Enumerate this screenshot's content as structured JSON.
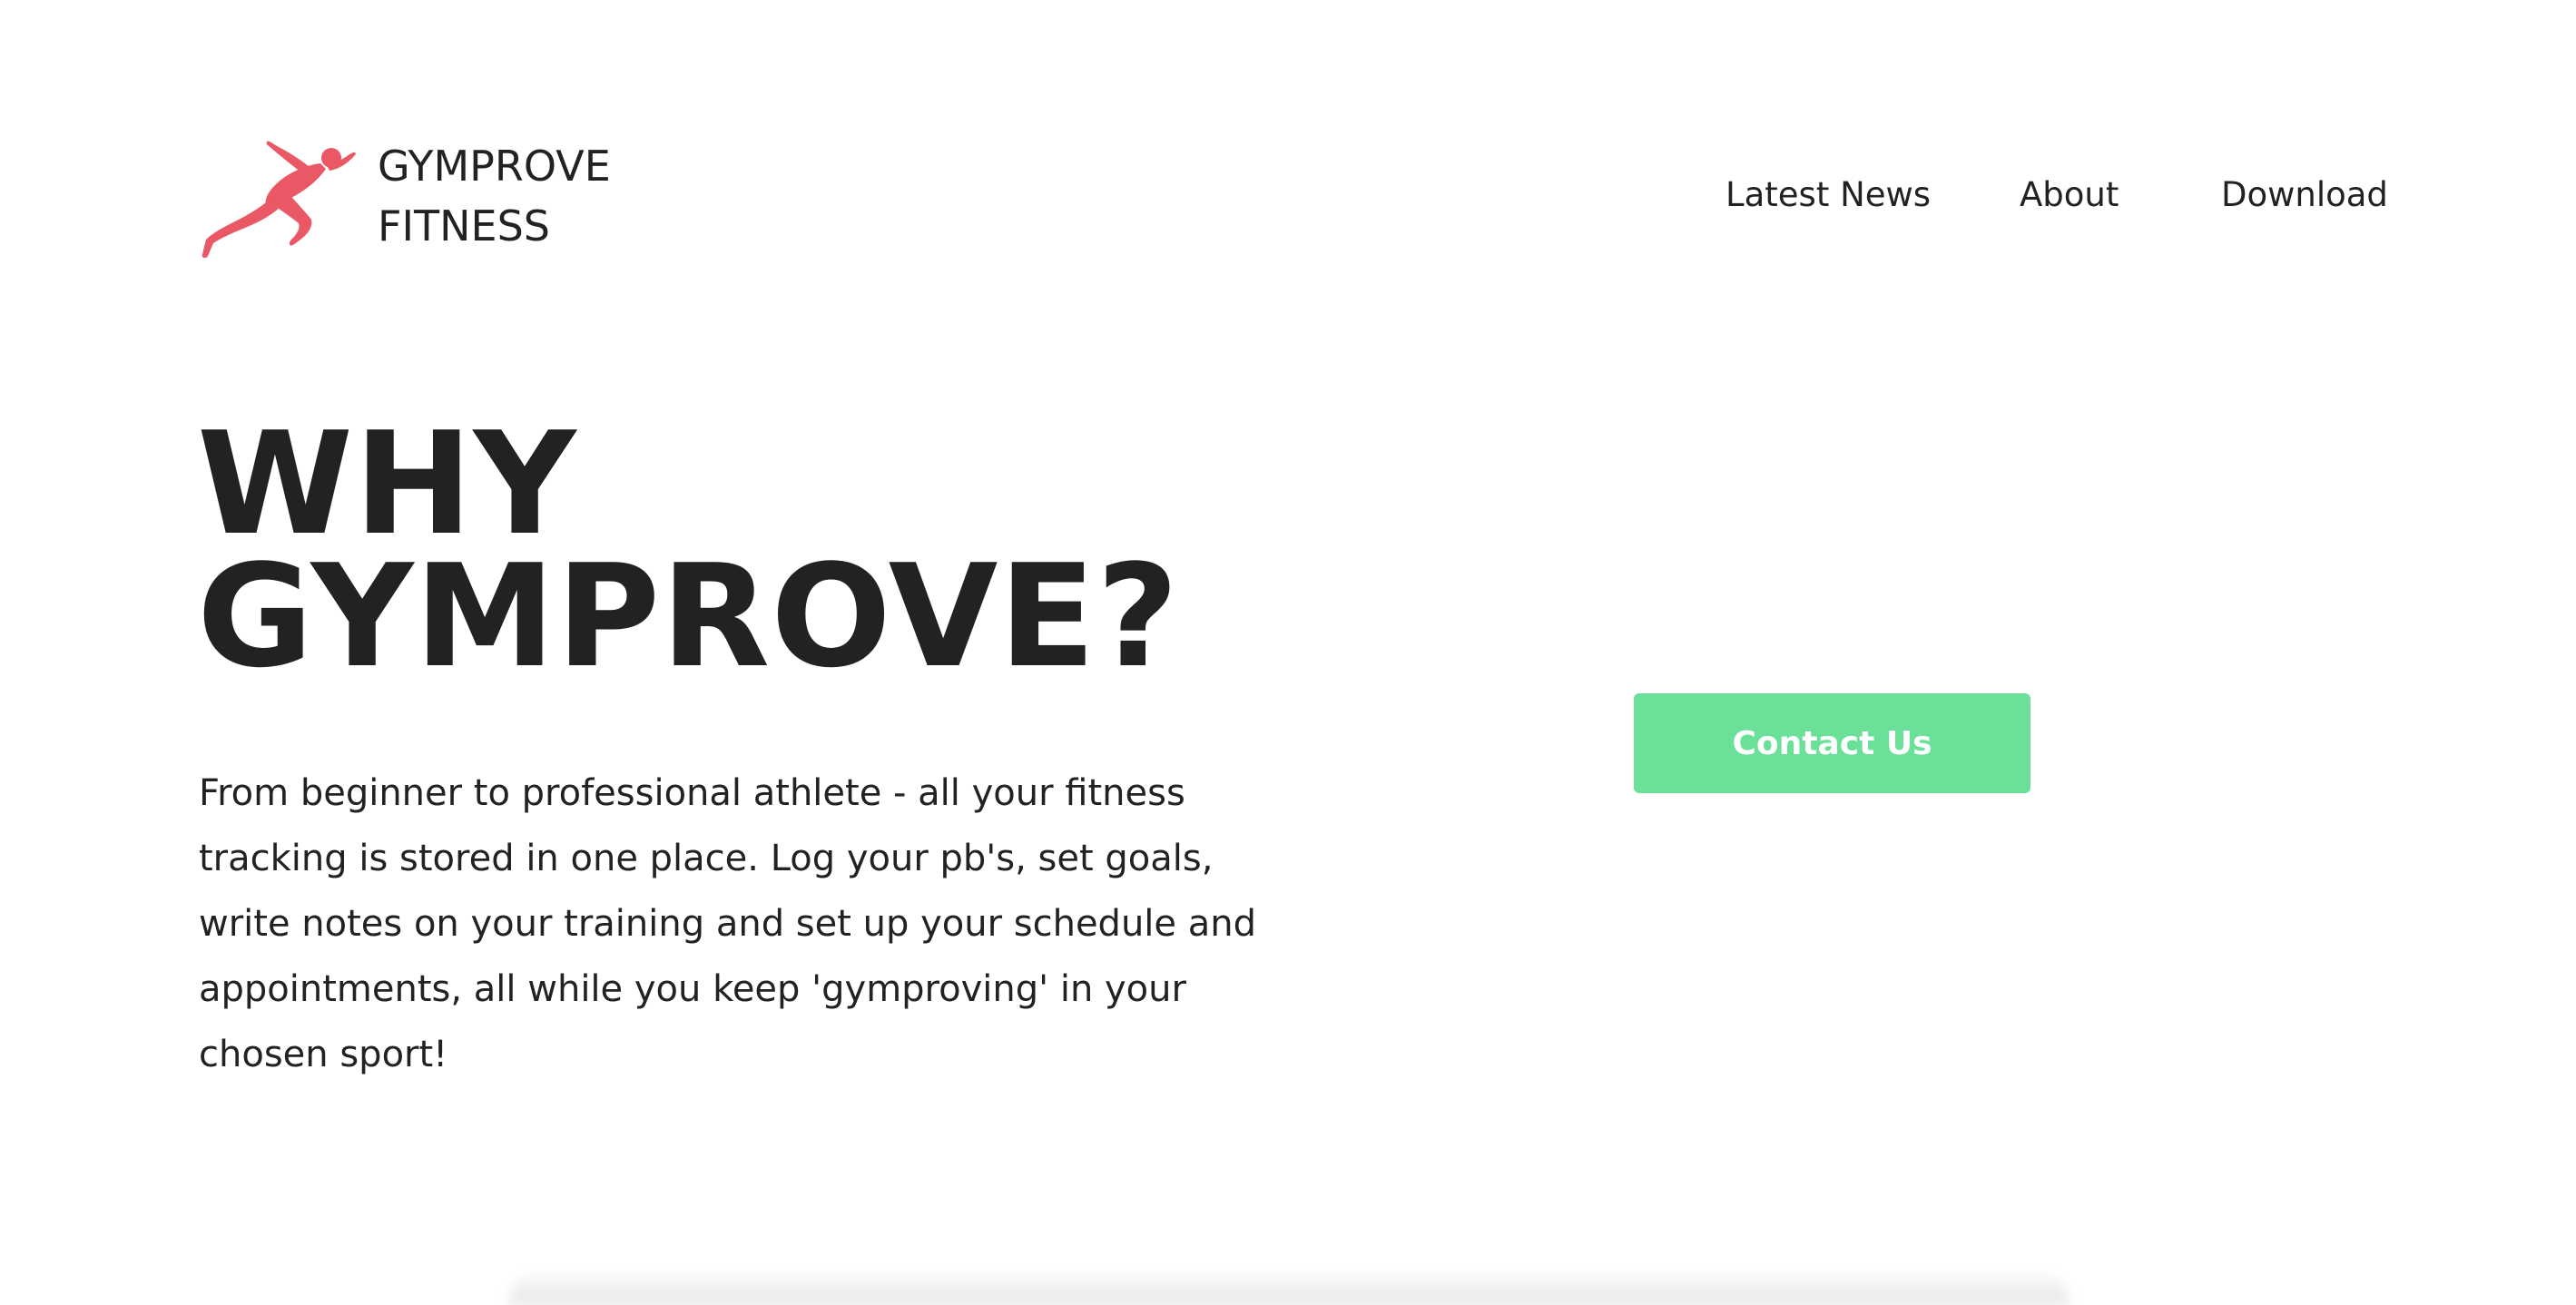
{
  "brand": {
    "logo_icon": "sprinter-icon",
    "line1": "GYMPROVE",
    "line2": "FITNESS",
    "accent_color": "#ea5865"
  },
  "nav": {
    "items": [
      {
        "label": "Latest News"
      },
      {
        "label": "About"
      },
      {
        "label": "Download"
      }
    ]
  },
  "hero": {
    "title_line1": "WHY",
    "title_line2": "GYMPROVE?",
    "description": "From beginner to professional athlete - all your fitness tracking is stored in one place. Log your pb's, set goals, write notes on your training and set up your schedule and appointments, all while you keep 'gymproving' in your chosen sport!"
  },
  "cta": {
    "label": "Contact Us",
    "color": "#6ae098"
  }
}
